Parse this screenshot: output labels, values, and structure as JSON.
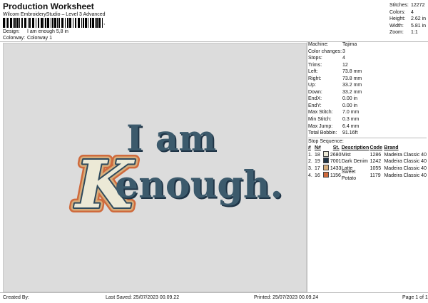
{
  "header": {
    "title": "Production Worksheet",
    "software": "Wilcom EmbroideryStudio – Level 3 Advanced",
    "barcode_suffix": ","
  },
  "meta": {
    "design_label": "Design:",
    "design_value": "I am enough 5,8 in",
    "colorway_label": "Colorway:",
    "colorway_value": "Colorway 1"
  },
  "summary": {
    "stitches_label": "Stitches:",
    "stitches_value": "12272",
    "colors_label": "Colors:",
    "colors_value": "4",
    "height_label": "Height:",
    "height_value": "2.62 in",
    "width_label": "Width:",
    "width_value": "5.81 in",
    "zoom_label": "Zoom:",
    "zoom_value": "1:1"
  },
  "design": {
    "line1": "I am",
    "line2_initial": "K",
    "line2_rest": "enough.",
    "colors": {
      "mist": "#ECE9D6",
      "dark_denim": "#2F4A5C",
      "latte": "#D7AE7C",
      "sweet_potato": "#CF6A3C"
    }
  },
  "details": [
    {
      "label": "Machine:",
      "value": "Tajima"
    },
    {
      "label": "Color changes:",
      "value": "3"
    },
    {
      "label": "Stops:",
      "value": "4"
    },
    {
      "label": "Trims:",
      "value": "12"
    },
    {
      "label": "Left:",
      "value": "73.8 mm"
    },
    {
      "label": "Right:",
      "value": "73.8 mm"
    },
    {
      "label": "Up:",
      "value": "33.2 mm"
    },
    {
      "label": "Down:",
      "value": "33.2 mm"
    },
    {
      "label": "EndX:",
      "value": "0.00 in"
    },
    {
      "label": "EndY:",
      "value": "0.00 in"
    },
    {
      "label": "Max Stitch:",
      "value": "7.0 mm"
    },
    {
      "label": "Min Stitch:",
      "value": "0.3 mm"
    },
    {
      "label": "Max Jump:",
      "value": "6.4 mm"
    },
    {
      "label": "Total Bobbin:",
      "value": "91.16ft"
    }
  ],
  "stop_sequence": {
    "title": "Stop Sequence:",
    "headers": {
      "idx": "#",
      "n": "N#",
      "st": "St.",
      "desc": "Description",
      "code": "Code",
      "brand": "Brand"
    },
    "rows": [
      {
        "idx": "1.",
        "n": "18",
        "color": "#ECE9D6",
        "st": "2680",
        "desc": "Mist",
        "code": "1286",
        "brand": "Madeira Classic 40"
      },
      {
        "idx": "2.",
        "n": "19",
        "color": "#1F3446",
        "st": "7001",
        "desc": "Dark Denim",
        "code": "1242",
        "brand": "Madeira Classic 40"
      },
      {
        "idx": "3.",
        "n": "17",
        "color": "#D7AE7C",
        "st": "1433",
        "desc": "Latte",
        "code": "1055",
        "brand": "Madeira Classic 40"
      },
      {
        "idx": "4.",
        "n": "16",
        "color": "#CF6A3C",
        "st": "1156",
        "desc": "Sweet Potato",
        "code": "1179",
        "brand": "Madeira Classic 40"
      }
    ]
  },
  "footer": {
    "created_by": "Created By:",
    "last_saved": "Last Saved: 25/07/2023 00.09.22",
    "printed": "Printed: 25/07/2023 00.09.24",
    "page": "Page 1 of 1"
  }
}
